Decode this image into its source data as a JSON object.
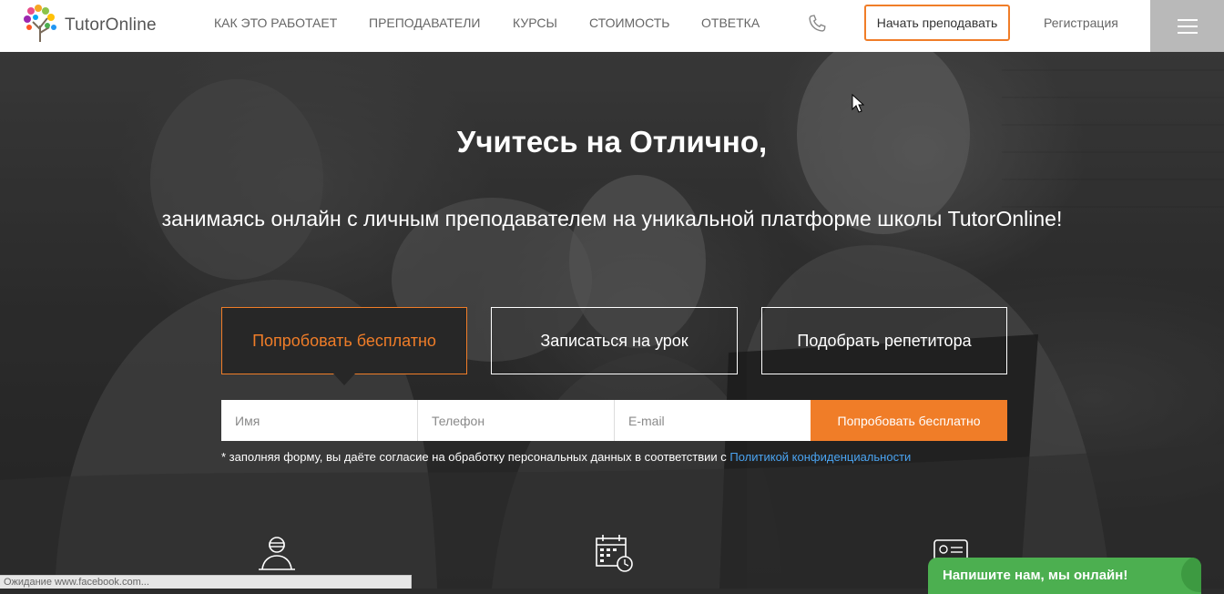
{
  "brand": {
    "name": "TutorOnline"
  },
  "nav": {
    "items": [
      {
        "label": "КАК ЭТО РАБОТАЕТ"
      },
      {
        "label": "ПРЕПОДАВАТЕЛИ"
      },
      {
        "label": "КУРСЫ"
      },
      {
        "label": "СТОИМОСТЬ"
      },
      {
        "label": "ОТВЕТКА"
      }
    ],
    "phone_icon": "phone-icon",
    "teach_button": "Начать преподавать",
    "register_link": "Регистрация",
    "menu_icon": "hamburger-menu-icon"
  },
  "hero": {
    "title": "Учитесь на Отлично,",
    "subtitle": "занимаясь онлайн с личным преподавателем на уникальной платформе школы TutorOnline!",
    "tabs": [
      {
        "label": "Попробовать бесплатно",
        "active": true
      },
      {
        "label": "Записаться на урок",
        "active": false
      },
      {
        "label": "Подобрать репетитора",
        "active": false
      }
    ],
    "form": {
      "name_placeholder": "Имя",
      "phone_placeholder": "Телефон",
      "email_placeholder": "E-mail",
      "submit_label": "Попробовать бесплатно"
    },
    "consent_text": "* заполняя форму, вы даёте согласие на обработку персональных данных в соответствии с ",
    "consent_link": "Политикой конфиденциальности",
    "feature_icons": [
      "teacher-icon",
      "calendar-clock-icon",
      "id-card-icon"
    ]
  },
  "status_bar": {
    "text": "Ожидание www.facebook.com..."
  },
  "chat": {
    "label": "Напишите нам, мы онлайн!"
  },
  "colors": {
    "accent": "#f07d28",
    "link": "#4aa3f0",
    "chat": "#4caf50",
    "menu_bg": "#b9b9b9"
  }
}
